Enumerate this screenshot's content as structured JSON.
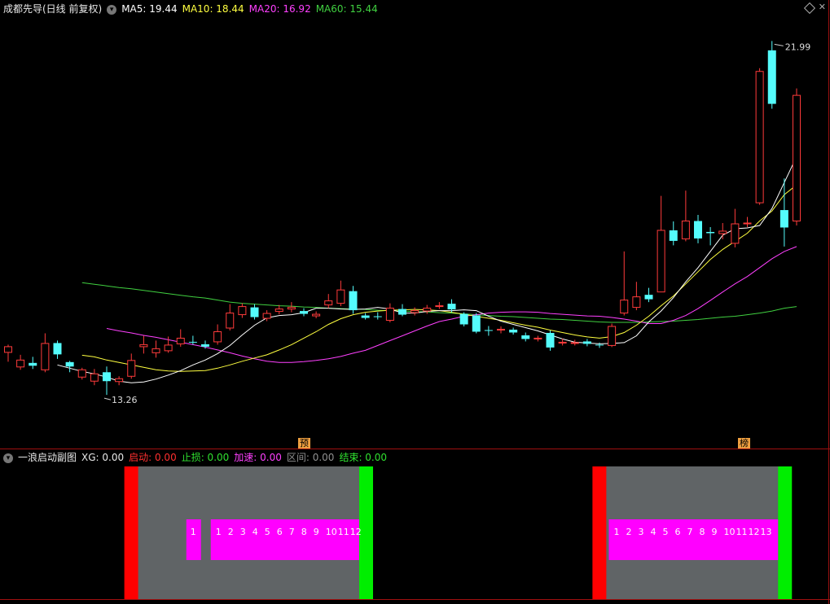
{
  "main_header": {
    "title": "成都先导(日线 前复权)",
    "ma5": "MA5: 19.44",
    "ma10": "MA10: 18.44",
    "ma20": "MA20: 16.92",
    "ma60": "MA60: 15.44"
  },
  "sub_header": {
    "title": "一浪启动副图",
    "xg": "XG: 0.00",
    "qidong": "启动: 0.00",
    "zhisun": "止损: 0.00",
    "jiasu": "加速: 0.00",
    "qujian": "区间: 0.00",
    "jieshu": "结束: 0.00"
  },
  "markers": {
    "yu": "预",
    "bang": "榜"
  },
  "colors": {
    "up": "#ff3b3b",
    "down": "#54fcfc",
    "ma5": "#ffffff",
    "ma10": "#ffff40",
    "ma20": "#ff40ff",
    "ma60": "#40d040",
    "zone": "#606466",
    "start": "#ff0000",
    "end": "#00ee00",
    "count": "#ff00ff"
  },
  "chart_data": {
    "type": "candlestick",
    "ylim": [
      12.4,
      22.6
    ],
    "high_label": "21.99",
    "low_label": "13.26",
    "candles": [
      [
        14.31,
        14.45,
        14.5,
        14.08
      ],
      [
        13.95,
        14.12,
        14.25,
        13.88
      ],
      [
        14.05,
        13.98,
        14.2,
        13.9
      ],
      [
        13.88,
        14.53,
        14.78,
        13.82
      ],
      [
        14.54,
        14.26,
        14.6,
        14.15
      ],
      [
        14.07,
        13.96,
        14.1,
        13.82
      ],
      [
        13.7,
        13.88,
        13.93,
        13.64
      ],
      [
        13.6,
        13.78,
        13.9,
        13.5
      ],
      [
        13.82,
        13.6,
        13.96,
        13.26
      ],
      [
        13.59,
        13.66,
        13.72,
        13.5
      ],
      [
        13.72,
        14.11,
        14.28,
        13.66
      ],
      [
        14.45,
        14.5,
        14.72,
        14.28
      ],
      [
        14.3,
        14.4,
        14.6,
        14.18
      ],
      [
        14.35,
        14.49,
        14.7,
        14.3
      ],
      [
        14.52,
        14.66,
        14.88,
        14.45
      ],
      [
        14.57,
        14.55,
        14.72,
        14.5
      ],
      [
        14.51,
        14.45,
        14.6,
        14.4
      ],
      [
        14.57,
        14.82,
        15.0,
        14.5
      ],
      [
        14.91,
        15.28,
        15.5,
        14.85
      ],
      [
        15.24,
        15.44,
        15.52,
        15.16
      ],
      [
        15.42,
        15.18,
        15.5,
        15.12
      ],
      [
        15.15,
        15.27,
        15.35,
        15.08
      ],
      [
        15.32,
        15.38,
        15.48,
        15.25
      ],
      [
        15.38,
        15.42,
        15.55,
        15.3
      ],
      [
        15.33,
        15.26,
        15.4,
        15.2
      ],
      [
        15.21,
        15.25,
        15.32,
        15.15
      ],
      [
        15.48,
        15.58,
        15.75,
        15.4
      ],
      [
        15.52,
        15.85,
        16.08,
        15.45
      ],
      [
        15.82,
        15.35,
        15.95,
        15.26
      ],
      [
        15.22,
        15.16,
        15.28,
        15.12
      ],
      [
        15.2,
        15.18,
        15.3,
        15.12
      ],
      [
        15.1,
        15.4,
        15.52,
        15.05
      ],
      [
        15.38,
        15.24,
        15.5,
        15.2
      ],
      [
        15.29,
        15.34,
        15.42,
        15.22
      ],
      [
        15.33,
        15.4,
        15.48,
        15.26
      ],
      [
        15.44,
        15.46,
        15.55,
        15.38
      ],
      [
        15.51,
        15.37,
        15.62,
        15.3
      ],
      [
        15.26,
        15.0,
        15.3,
        14.95
      ],
      [
        15.22,
        14.82,
        15.28,
        14.78
      ],
      [
        14.86,
        14.84,
        14.96,
        14.72
      ],
      [
        14.86,
        14.88,
        14.95,
        14.78
      ],
      [
        14.87,
        14.8,
        14.92,
        14.75
      ],
      [
        14.73,
        14.64,
        14.8,
        14.58
      ],
      [
        14.64,
        14.66,
        14.72,
        14.58
      ],
      [
        14.79,
        14.43,
        14.85,
        14.35
      ],
      [
        14.54,
        14.56,
        14.65,
        14.48
      ],
      [
        14.55,
        14.55,
        14.62,
        14.48
      ],
      [
        14.58,
        14.52,
        14.64,
        14.46
      ],
      [
        14.5,
        14.48,
        14.55,
        14.42
      ],
      [
        14.48,
        14.95,
        15.02,
        14.44
      ],
      [
        15.28,
        15.6,
        16.8,
        15.22
      ],
      [
        15.42,
        15.68,
        16.05,
        15.35
      ],
      [
        15.73,
        15.62,
        15.9,
        15.55
      ],
      [
        15.8,
        17.32,
        18.17,
        15.8
      ],
      [
        17.32,
        17.06,
        17.54,
        16.95
      ],
      [
        17.11,
        17.55,
        18.3,
        17.05
      ],
      [
        17.55,
        17.12,
        17.7,
        17.0
      ],
      [
        17.28,
        17.25,
        17.4,
        16.95
      ],
      [
        17.24,
        17.3,
        17.5,
        17.1
      ],
      [
        17.0,
        17.48,
        17.85,
        16.9
      ],
      [
        17.49,
        17.5,
        17.65,
        17.4
      ],
      [
        18.0,
        21.24,
        21.32,
        17.95
      ],
      [
        21.76,
        20.44,
        21.99,
        20.32
      ],
      [
        17.82,
        17.39,
        18.6,
        16.92
      ],
      [
        17.55,
        20.65,
        20.82,
        17.44
      ]
    ],
    "ma5": [
      14.0,
      13.92,
      13.84,
      13.78,
      13.7,
      13.6,
      13.56,
      13.58,
      13.65,
      13.75,
      13.86,
      14.0,
      14.12,
      14.28,
      14.48,
      14.74,
      14.98,
      15.16,
      15.22,
      15.24,
      15.29,
      15.4,
      15.4,
      15.38,
      15.37,
      15.38,
      15.42,
      15.38,
      15.28,
      15.28,
      15.32,
      15.34,
      15.34,
      15.36,
      15.34,
      15.2,
      15.08,
      15.0,
      14.92,
      14.84,
      14.74,
      14.64,
      14.56,
      14.54,
      14.52,
      14.53,
      14.55,
      14.72,
      15.06,
      15.33,
      15.66,
      16.05,
      16.4,
      16.8,
      17.2,
      17.36,
      17.38,
      17.44,
      17.86,
      18.5,
      19.14
    ],
    "ma10": [
      14.24,
      14.2,
      14.12,
      14.06,
      14.0,
      13.94,
      13.88,
      13.85,
      13.84,
      13.85,
      13.86,
      13.92,
      14.0,
      14.09,
      14.17,
      14.25,
      14.37,
      14.5,
      14.66,
      14.82,
      15.0,
      15.14,
      15.24,
      15.3,
      15.33,
      15.35,
      15.36,
      15.37,
      15.36,
      15.34,
      15.3,
      15.25,
      15.2,
      15.15,
      15.1,
      15.04,
      14.98,
      14.93,
      14.86,
      14.8,
      14.74,
      14.69,
      14.66,
      14.7,
      14.8,
      14.98,
      15.2,
      15.46,
      15.7,
      16.0,
      16.3,
      16.6,
      16.85,
      17.05,
      17.25,
      17.55,
      17.8,
      18.2,
      18.44
    ],
    "ma20": [
      14.9,
      14.84,
      14.79,
      14.73,
      14.68,
      14.62,
      14.56,
      14.5,
      14.44,
      14.37,
      14.3,
      14.22,
      14.15,
      14.09,
      14.06,
      14.06,
      14.08,
      14.11,
      14.15,
      14.21,
      14.29,
      14.36,
      14.48,
      14.6,
      14.72,
      14.84,
      14.96,
      15.07,
      15.13,
      15.2,
      15.24,
      15.28,
      15.3,
      15.31,
      15.31,
      15.3,
      15.27,
      15.25,
      15.23,
      15.21,
      15.2,
      15.17,
      15.13,
      15.08,
      15.02,
      15.02,
      15.1,
      15.22,
      15.39,
      15.59,
      15.8,
      16.0,
      16.18,
      16.4,
      16.62,
      16.8,
      16.92
    ],
    "ma60": [
      16.03,
      15.99,
      15.95,
      15.91,
      15.88,
      15.84,
      15.8,
      15.76,
      15.72,
      15.68,
      15.65,
      15.6,
      15.55,
      15.52,
      15.5,
      15.48,
      15.46,
      15.45,
      15.43,
      15.42,
      15.4,
      15.39,
      15.38,
      15.37,
      15.35,
      15.34,
      15.33,
      15.32,
      15.31,
      15.29,
      15.28,
      15.26,
      15.24,
      15.22,
      15.2,
      15.19,
      15.17,
      15.15,
      15.13,
      15.12,
      15.1,
      15.08,
      15.06,
      15.05,
      15.05,
      15.05,
      15.06,
      15.07,
      15.08,
      15.1,
      15.12,
      15.15,
      15.18,
      15.2,
      15.24,
      15.28,
      15.33,
      15.4,
      15.44
    ],
    "segments": [
      {
        "start": 10,
        "end": 28,
        "numbers": [
          "1",
          "1",
          "2",
          "3",
          "4",
          "5",
          "6",
          "7",
          "8",
          "9",
          "10",
          "11",
          "12"
        ]
      },
      {
        "start": 48,
        "end": 62,
        "numbers": [
          "1",
          "2",
          "3",
          "4",
          "5",
          "6",
          "7",
          "8",
          "9",
          "10",
          "11",
          "12",
          "13"
        ]
      }
    ]
  }
}
